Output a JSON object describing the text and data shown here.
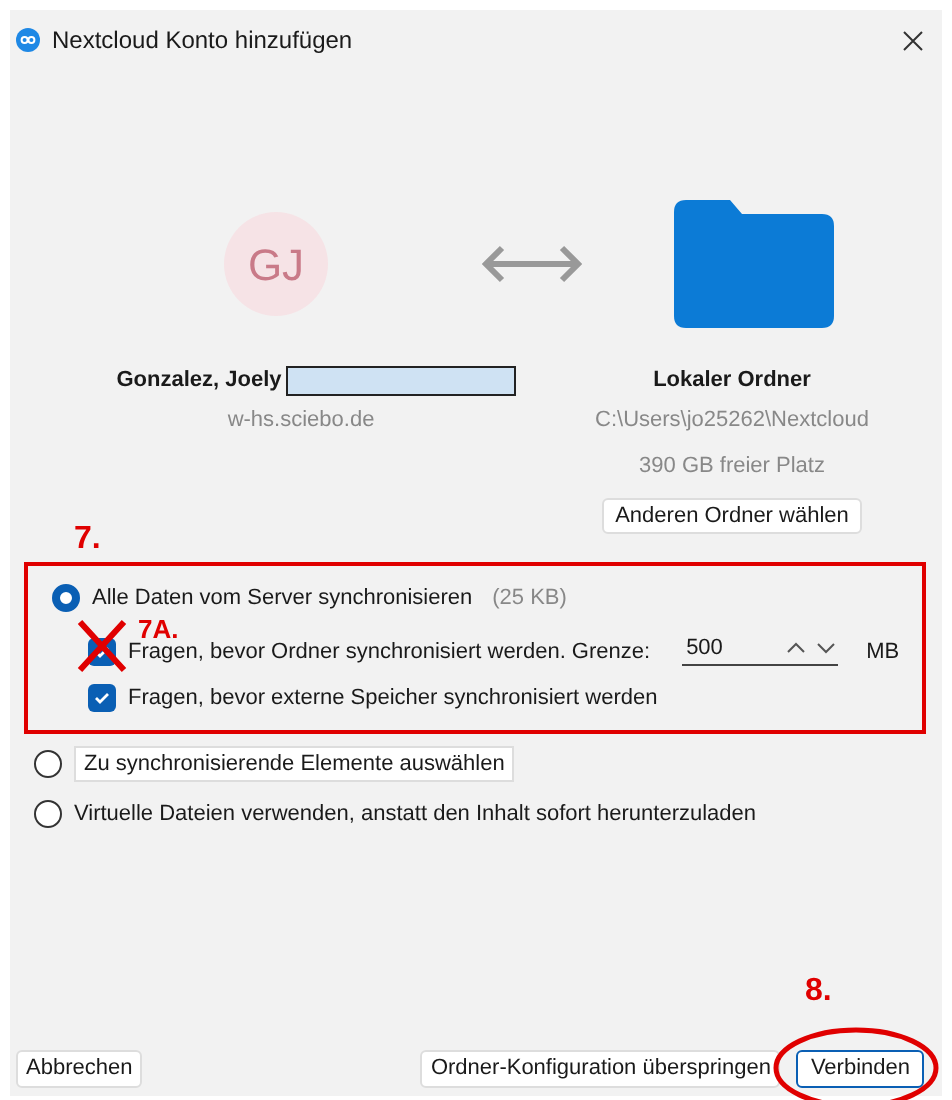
{
  "window": {
    "title": "Nextcloud Konto hinzufügen"
  },
  "account": {
    "initials": "GJ",
    "name": "Gonzalez, Joely",
    "redacted": true,
    "host": "w-hs.sciebo.de"
  },
  "folder": {
    "title": "Lokaler Ordner",
    "path": "C:\\Users\\jo25262\\Nextcloud",
    "free_space": "390 GB freier Platz",
    "change_button": "Anderen Ordner wählen"
  },
  "annotation_sync": {
    "label": "7."
  },
  "options": [
    {
      "kind": "plain",
      "label": "Alle Daten vom Server synchronisieren",
      "size": "(25 KB)",
      "selected": true,
      "sub_options": [
        {
          "kind": "limit",
          "label": "Fragen, bevor Ordner synchronisiert werden. Grenze:",
          "checked": true,
          "crossed_out": true,
          "mark": "7A.",
          "value": "500",
          "unit": "MB"
        },
        {
          "kind": "plain",
          "label": "Fragen, bevor externe Speicher synchronisiert werden",
          "checked": true,
          "crossed_out": false
        }
      ]
    },
    {
      "kind": "button",
      "label": "Zu synchronisierende Elemente auswählen",
      "selected": false
    },
    {
      "kind": "plain",
      "label": "Virtuelle Dateien verwenden, anstatt den Inhalt sofort herunterzuladen",
      "selected": false
    }
  ],
  "buttons": [
    {
      "label": "Abbrechen",
      "circled": false
    },
    {
      "label": "Ordner-Konfiguration überspringen",
      "circled": false
    },
    {
      "label": "Verbinden",
      "circled": true,
      "mark": "8."
    }
  ]
}
